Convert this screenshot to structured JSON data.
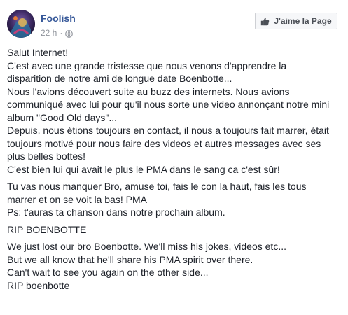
{
  "post": {
    "page_name": "Foolish",
    "time": "22 h",
    "separator": "·",
    "privacy_icon": "globe-icon",
    "like_button_label": "J'aime la Page",
    "like_button_icon": "thumbs-up-icon",
    "colors": {
      "page_name": "#365899",
      "meta": "#90949c",
      "text": "#1d2129",
      "button_border": "#ced0d4",
      "button_bg": "#f6f7f9"
    },
    "paragraphs": [
      {
        "lines": [
          "Salut Internet!",
          "C'est avec une grande tristesse que nous venons d'apprendre la",
          "disparition de notre ami de longue date Boenbotte...",
          "Nous l'avions découvert suite au buzz des internets. Nous avions",
          "communiqué avec lui pour qu'il nous sorte une video annonçant notre mini",
          "album \"Good Old days\"...",
          "Depuis, nous étions toujours en contact, il nous a toujours fait marrer, était",
          "toujours motivé pour nous faire des videos et autres messages avec ses",
          "plus belles bottes!",
          "C'est bien lui qui avait le plus le PMA dans le sang ca c'est sûr!"
        ]
      },
      {
        "lines": [
          "Tu vas nous manquer Bro, amuse toi, fais le con la haut, fais les tous",
          "marrer et on se voit la bas! PMA",
          "Ps: t'auras ta chanson dans notre prochain album."
        ]
      },
      {
        "lines": [
          "RIP BOENBOTTE"
        ]
      },
      {
        "lines": [
          "We just lost our bro Boenbotte. We'll miss his jokes, videos etc...",
          "But we all know that he'll share his PMA spirit over there.",
          "Can't wait to see you again on the other side...",
          "RIP boenbotte"
        ]
      }
    ]
  }
}
